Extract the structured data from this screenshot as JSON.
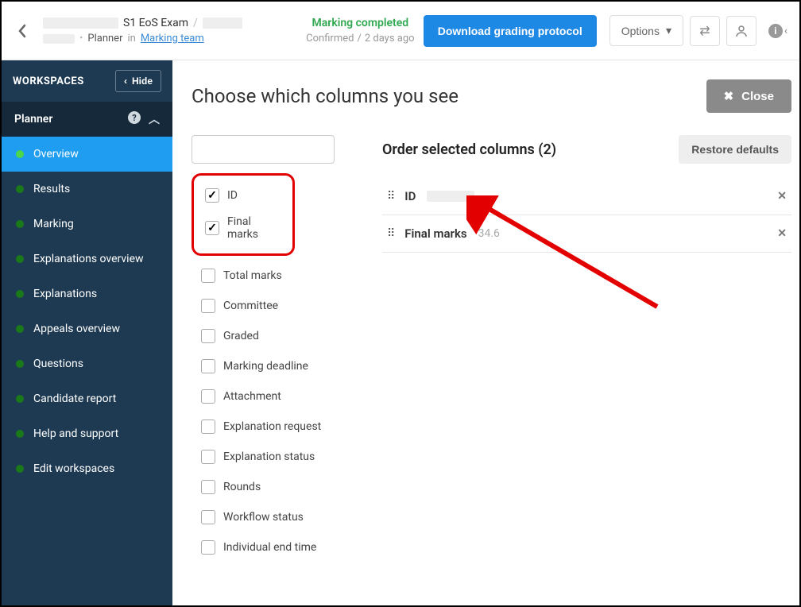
{
  "header": {
    "exam_title_mid": "S1 EoS Exam",
    "planner_label": "Planner",
    "in_word": "in",
    "team_link": "Marking team",
    "status_main": "Marking completed",
    "status_confirmed": "Confirmed",
    "status_age": "2 days ago",
    "download_btn": "Download grading protocol",
    "options_btn": "Options"
  },
  "sidebar": {
    "workspaces": "WORKSPACES",
    "hide_btn": "Hide",
    "section_title": "Planner",
    "items": [
      "Overview",
      "Results",
      "Marking",
      "Explanations overview",
      "Explanations",
      "Appeals overview",
      "Questions",
      "Candidate report",
      "Help and support",
      "Edit workspaces"
    ]
  },
  "content": {
    "title": "Choose which columns you see",
    "close_btn": "Close",
    "order_title_prefix": "Order selected columns",
    "order_count": "2",
    "restore_btn": "Restore defaults",
    "available": [
      {
        "label": "ID",
        "checked": true,
        "highlighted": true
      },
      {
        "label": "Final marks",
        "checked": true,
        "highlighted": true
      },
      {
        "label": "Total marks",
        "checked": false
      },
      {
        "label": "Committee",
        "checked": false
      },
      {
        "label": "Graded",
        "checked": false
      },
      {
        "label": "Marking deadline",
        "checked": false
      },
      {
        "label": "Attachment",
        "checked": false
      },
      {
        "label": "Explanation request",
        "checked": false
      },
      {
        "label": "Explanation status",
        "checked": false
      },
      {
        "label": "Rounds",
        "checked": false
      },
      {
        "label": "Workflow status",
        "checked": false
      },
      {
        "label": "Individual end time",
        "checked": false
      }
    ],
    "ordered": [
      {
        "label": "ID",
        "value_redacted": true
      },
      {
        "label": "Final marks",
        "value": "34.6"
      }
    ]
  }
}
